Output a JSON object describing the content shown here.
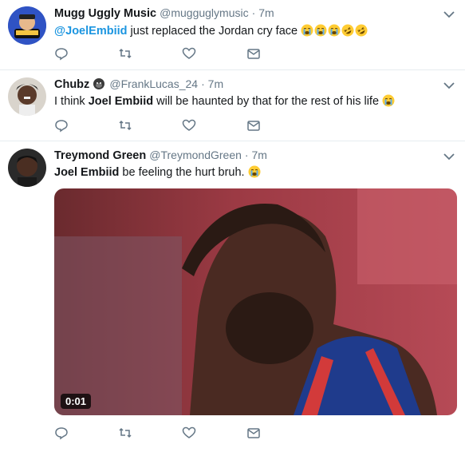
{
  "tweets": [
    {
      "name": "Mugg Uggly Music",
      "handle": "@mugguglymusic",
      "time": "· 7m",
      "text": {
        "mention": "@JoelEmbiid",
        "body": " just replaced the Jordan cry face "
      },
      "emojis": [
        "crying-face",
        "crying-face",
        "crying-face",
        "rofl-face",
        "rofl-face"
      ]
    },
    {
      "name": "Chubz",
      "handle": "@FrankLucas_24",
      "time": "· 7m",
      "text": {
        "pre": "I think ",
        "bold": "Joel Embiid",
        "post": " will be haunted by that for the rest of his life "
      },
      "emojis": [
        "crying-face"
      ]
    },
    {
      "name": "Treymond Green",
      "handle": "@TreymondGreen",
      "time": "· 7m",
      "text": {
        "bold": "Joel Embiid",
        "post": " be feeling the hurt bruh. "
      },
      "emojis": [
        "crying-face"
      ],
      "media": {
        "timer": "0:01"
      }
    }
  ],
  "icons": {
    "reply": "reply-icon",
    "retweet": "retweet-icon",
    "like": "heart-icon",
    "dm": "envelope-icon",
    "caret": "chevron-down-icon"
  },
  "colors": {
    "mention": "#1b95e0",
    "muted": "#657786",
    "border": "#e6ecf0"
  }
}
